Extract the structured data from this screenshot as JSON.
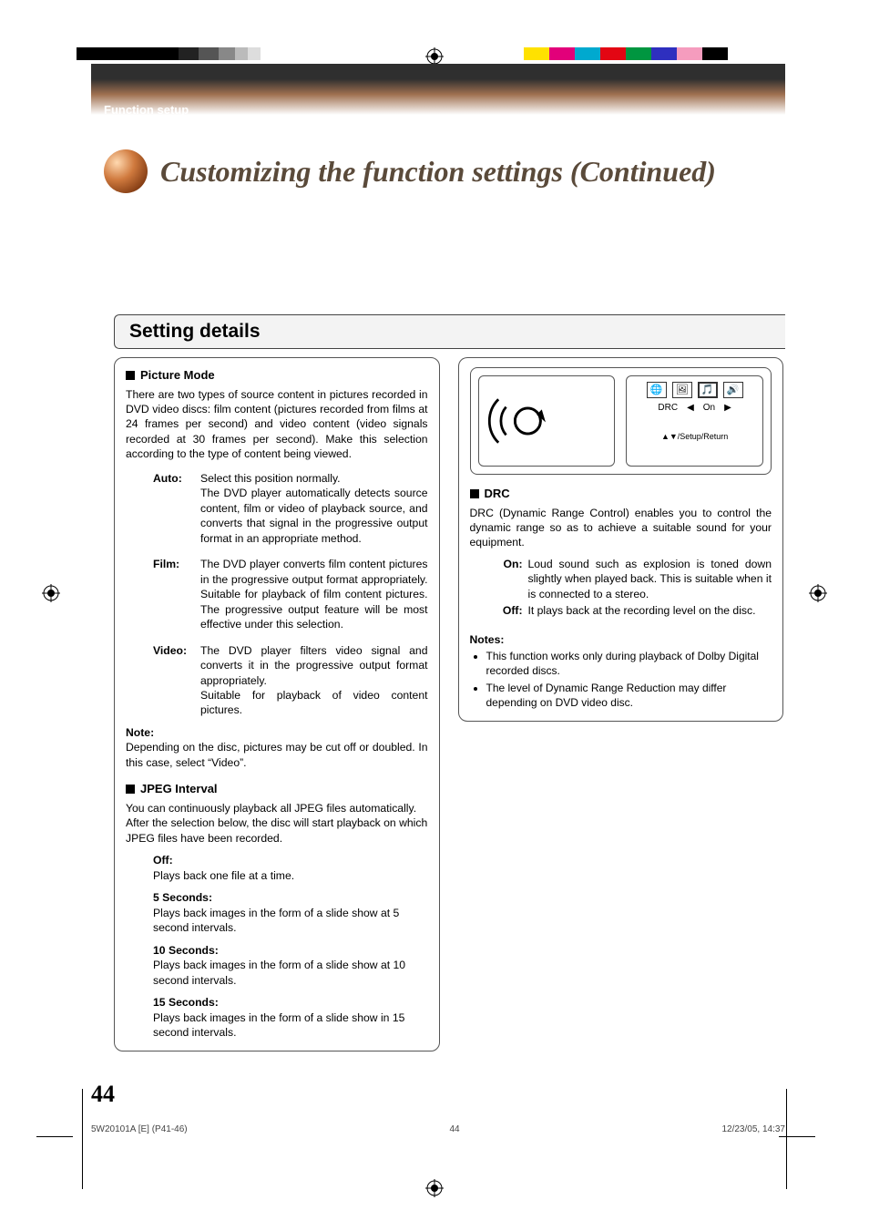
{
  "header": {
    "section": "Function setup"
  },
  "title": "Customizing the function settings (Continued)",
  "section_heading": "Setting details",
  "left": {
    "pm_head": "Picture Mode",
    "pm_intro": "There are two types of source content in pictures recorded in DVD video discs: film content (pictures recorded from films at 24 frames per second) and video content (video signals recorded at 30 frames per second). Make this selection according to the type of content being viewed.",
    "pm_opts": [
      {
        "label": "Auto:",
        "desc1": "Select this position normally.",
        "desc2": "The DVD player automatically detects source content, film or video of playback source, and converts that signal in the progressive output format in an appropriate method."
      },
      {
        "label": "Film:",
        "desc1": "The DVD player converts film content pictures in the progressive output format appropriately. Suitable for playback of film content pictures. The progressive output feature will be most effective under this selection.",
        "desc2": ""
      },
      {
        "label": "Video:",
        "desc1": "The DVD player filters video signal and converts it in the progressive output format appropriately.",
        "desc2": "Suitable for playback of video content pictures."
      }
    ],
    "pm_note_label": "Note:",
    "pm_note_body": "Depending on the disc, pictures may be cut off or doubled. In this case, select “Video”.",
    "jpeg_head": "JPEG Interval",
    "jpeg_intro1": "You can continuously playback all JPEG files automatically.",
    "jpeg_intro2": "After the selection below, the disc will start playback on which JPEG files have been recorded.",
    "jpeg_opts": [
      {
        "label": "Off:",
        "desc": "Plays back one file at a time."
      },
      {
        "label": "5 Seconds:",
        "desc": "Plays back images in the form of a slide show at 5 second intervals."
      },
      {
        "label": "10 Seconds:",
        "desc": "Plays back images in the form of a slide show at 10 second intervals."
      },
      {
        "label": "15 Seconds:",
        "desc": "Plays back images in the form of a slide show in 15 second intervals."
      }
    ]
  },
  "right": {
    "osd": {
      "label": "DRC",
      "value": "On",
      "footer": "▲▼/Setup/Return"
    },
    "drc_head": "DRC",
    "drc_intro": "DRC (Dynamic Range Control) enables you to control the dynamic range so as to achieve a suitable sound for your equipment.",
    "drc_opts": [
      {
        "label": "On:",
        "desc": "Loud sound such as explosion is toned down slightly when played back. This is suitable when it is connected to a stereo."
      },
      {
        "label": "Off:",
        "desc": "It plays back at the recording level on the disc."
      }
    ],
    "notes_label": "Notes:",
    "notes": [
      "This function works only during playback of Dolby Digital recorded discs.",
      "The level of Dynamic Range Reduction may differ depending on DVD video disc."
    ]
  },
  "page_number": "44",
  "footer": {
    "left": "5W20101A [E] (P41-46)",
    "center": "44",
    "right": "12/23/05, 14:37"
  }
}
